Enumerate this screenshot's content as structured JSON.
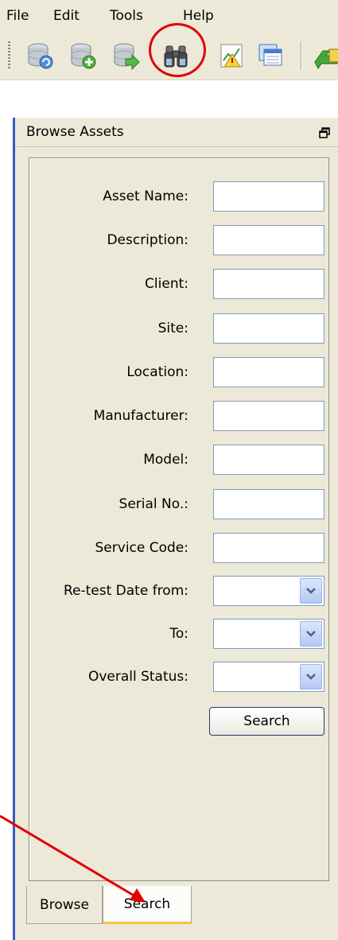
{
  "menubar": {
    "items": [
      {
        "label": "File"
      },
      {
        "label": "Edit"
      },
      {
        "label": "Tools"
      },
      {
        "label": "Help"
      }
    ]
  },
  "toolbar": {
    "buttons": [
      {
        "icon": "database-refresh-icon"
      },
      {
        "icon": "database-add-icon"
      },
      {
        "icon": "database-import-icon"
      },
      {
        "icon": "binoculars-search-icon"
      },
      {
        "icon": "report-chart-icon"
      },
      {
        "icon": "windows-icon"
      },
      {
        "icon": "green-arrow-icon"
      }
    ]
  },
  "panel": {
    "title": "Browse Assets",
    "form": {
      "fields": [
        {
          "label": "Asset Name:",
          "type": "text",
          "value": ""
        },
        {
          "label": "Description:",
          "type": "text",
          "value": ""
        },
        {
          "label": "Client:",
          "type": "text",
          "value": ""
        },
        {
          "label": "Site:",
          "type": "text",
          "value": ""
        },
        {
          "label": "Location:",
          "type": "text",
          "value": ""
        },
        {
          "label": "Manufacturer:",
          "type": "text",
          "value": ""
        },
        {
          "label": "Model:",
          "type": "text",
          "value": ""
        },
        {
          "label": "Serial No.:",
          "type": "text",
          "value": ""
        },
        {
          "label": "Service Code:",
          "type": "text",
          "value": ""
        },
        {
          "label": "Re-test Date from:",
          "type": "combo",
          "value": ""
        },
        {
          "label": "To:",
          "type": "combo",
          "value": ""
        },
        {
          "label": "Overall Status:",
          "type": "combo",
          "value": ""
        }
      ],
      "search_label": "Search"
    },
    "tabs": [
      {
        "label": "Browse",
        "active": false
      },
      {
        "label": "Search",
        "active": true
      }
    ]
  },
  "colors": {
    "annotation": "#e00000",
    "panel_accent": "#3a57c9",
    "active_tab_underline": "#f4c04a"
  }
}
